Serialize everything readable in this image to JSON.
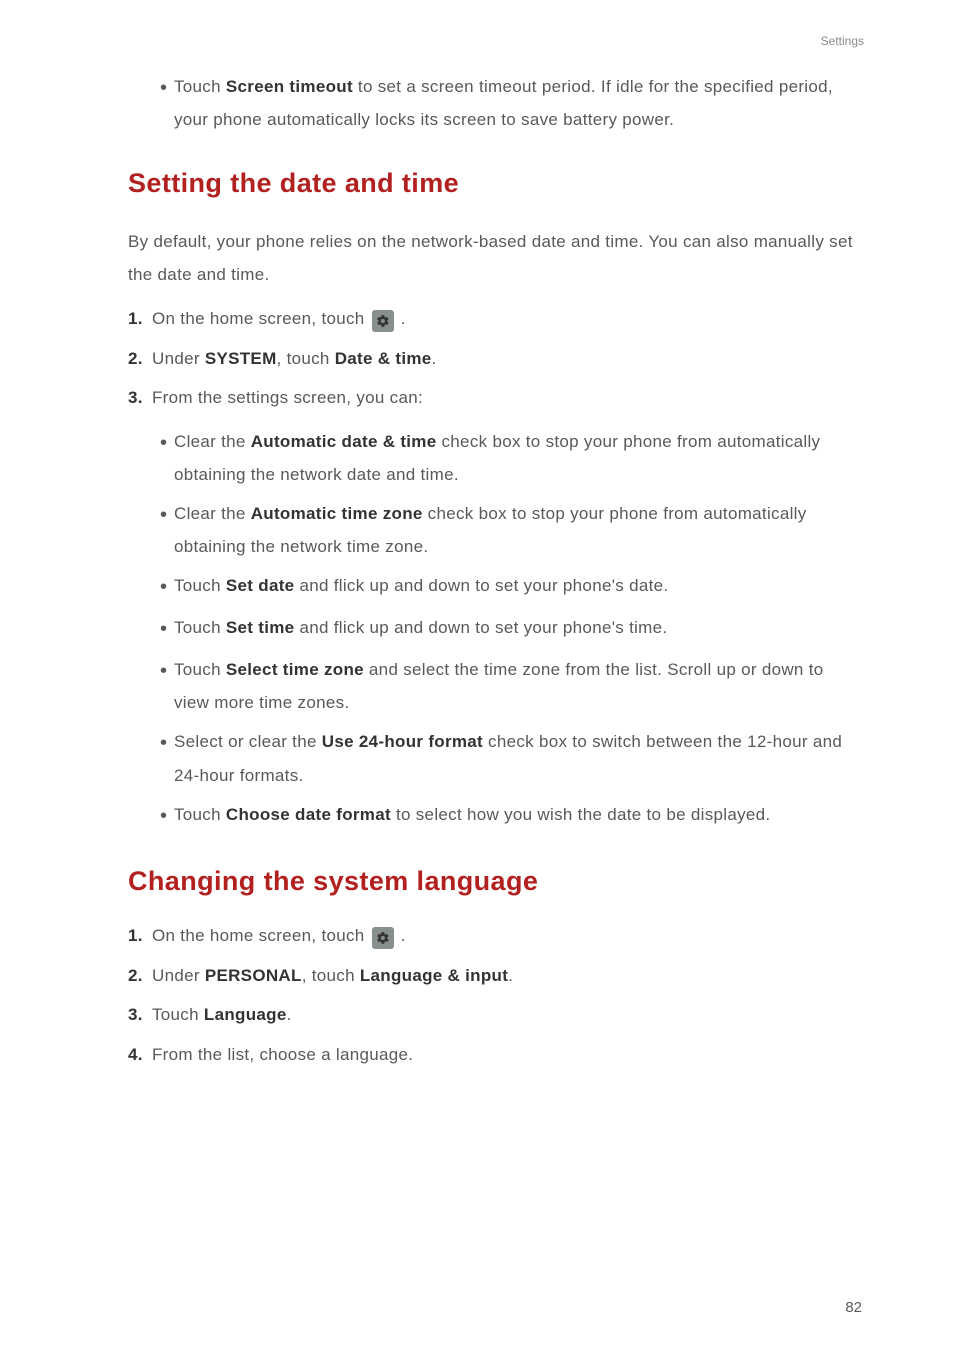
{
  "header_label": "Settings",
  "top_bullet": {
    "pre": "Touch ",
    "bold": "Screen timeout",
    "post": " to set a screen timeout period. If idle for the specified period, your phone automatically locks its screen to save battery power."
  },
  "section1": {
    "title": "Setting the date and time",
    "intro": "By default, your phone relies on the network-based date and time. You can also manually set the date and time.",
    "steps": {
      "s1": {
        "num": "1.",
        "text": "On the home screen, touch ",
        "after_icon": " ."
      },
      "s2": {
        "num": "2.",
        "pre": "Under ",
        "b1": "SYSTEM",
        "mid": ", touch ",
        "b2": "Date & time",
        "post": "."
      },
      "s3": {
        "num": "3.",
        "text": "From the settings screen, you can:"
      }
    },
    "bullets": {
      "b1": {
        "pre": "Clear the ",
        "bold": "Automatic date & time",
        "post": " check box to stop your phone from automatically obtaining the network date and time."
      },
      "b2": {
        "pre": "Clear the ",
        "bold": "Automatic time zone",
        "post": " check box to stop your phone from automatically obtaining the network time zone."
      },
      "b3": {
        "pre": "Touch ",
        "bold": "Set date",
        "post": " and flick up and down to set your phone's date."
      },
      "b4": {
        "pre": "Touch ",
        "bold": "Set time",
        "post": " and flick up and down to set your phone's time."
      },
      "b5": {
        "pre": "Touch ",
        "bold": "Select time zone",
        "post": " and select the time zone from the list. Scroll up or down to view more time zones."
      },
      "b6": {
        "pre": "Select or clear the ",
        "bold": "Use 24-hour format",
        "post": " check box to switch between the 12-hour and 24-hour formats."
      },
      "b7": {
        "pre": "Touch ",
        "bold": "Choose date format",
        "post": " to select how you wish the date to be displayed."
      }
    }
  },
  "section2": {
    "title": "Changing the system language",
    "steps": {
      "s1": {
        "num": "1.",
        "text": "On the home screen, touch ",
        "after_icon": " ."
      },
      "s2": {
        "num": "2.",
        "pre": "Under ",
        "b1": "PERSONAL",
        "mid": ", touch ",
        "b2": "Language & input",
        "post": "."
      },
      "s3": {
        "num": "3.",
        "pre": "Touch ",
        "b1": "Language",
        "post": "."
      },
      "s4": {
        "num": "4.",
        "text": "From the list, choose a language."
      }
    }
  },
  "page_number": "82"
}
